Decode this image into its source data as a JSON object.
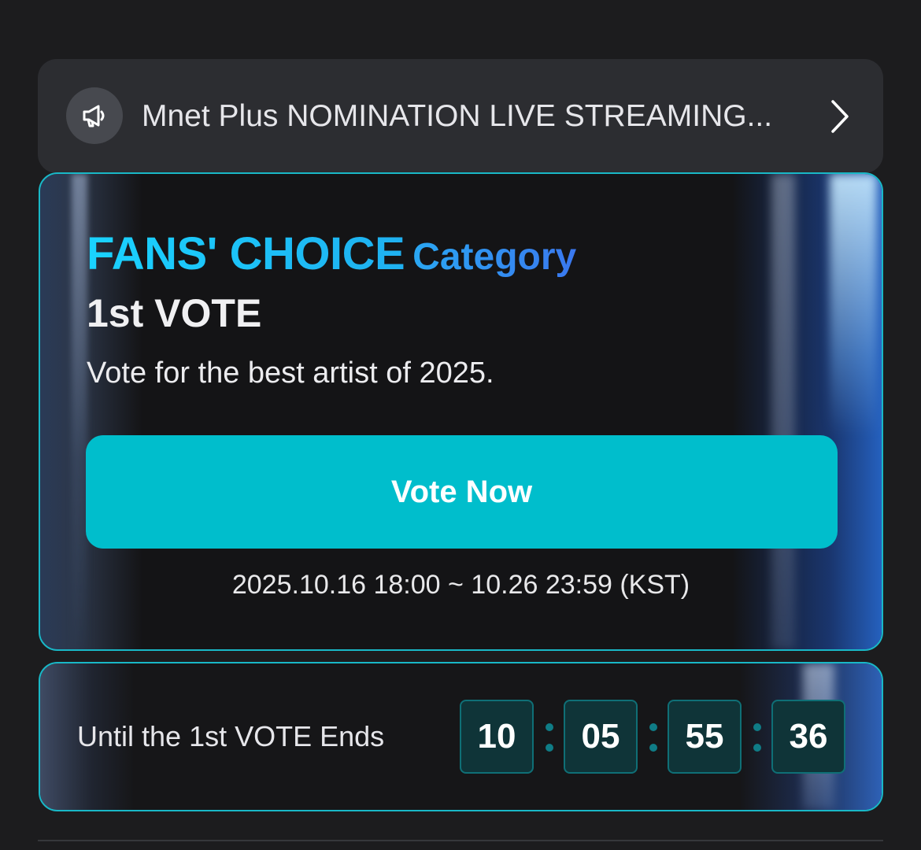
{
  "notice": {
    "text": "Mnet Plus NOMINATION LIVE STREAMING...",
    "icon": "megaphone-icon",
    "chevron": "chevron-right-icon"
  },
  "vote_card": {
    "headline_main": "FANS' CHOICE",
    "headline_sub": "Category",
    "round": "1st VOTE",
    "description": "Vote for the best artist of 2025.",
    "button_label": "Vote Now",
    "period": "2025.10.16 18:00 ~ 10.26 23:59 (KST)"
  },
  "countdown": {
    "label": "Until the 1st VOTE Ends",
    "days": "10",
    "hours": "05",
    "minutes": "55",
    "seconds": "36"
  },
  "colors": {
    "accent": "#00becc",
    "border": "#19b8c7",
    "background": "#1c1c1e"
  }
}
